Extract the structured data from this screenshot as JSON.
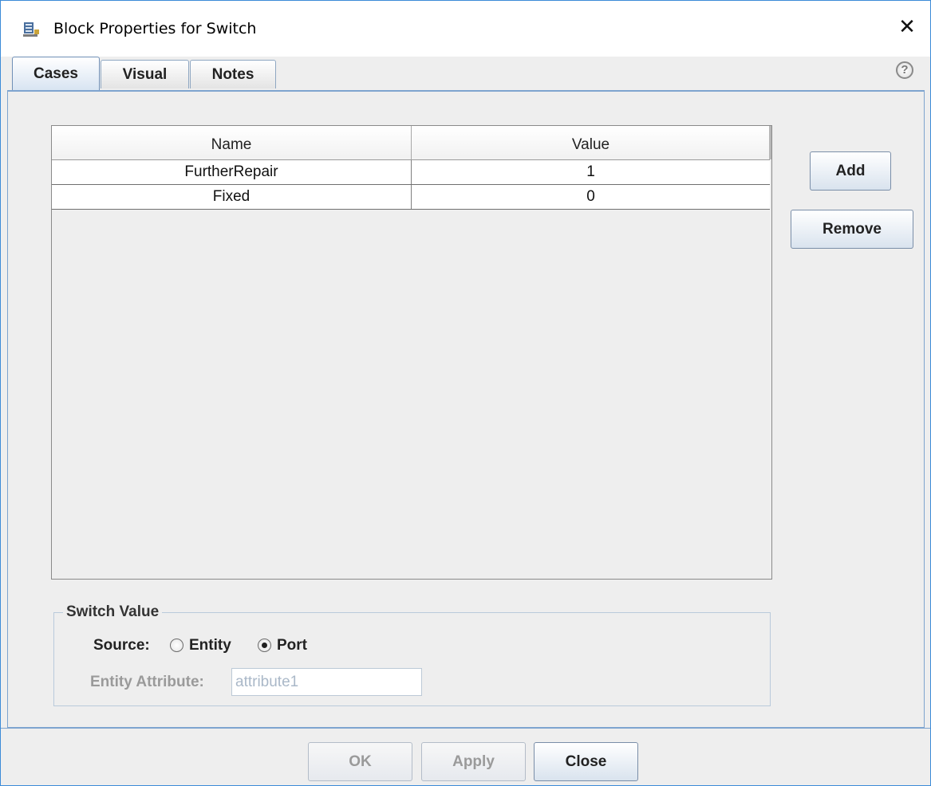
{
  "window": {
    "title": "Block Properties for Switch",
    "app_icon": "block-properties-icon",
    "close_glyph": "✕"
  },
  "tabs": [
    {
      "label": "Cases",
      "active": true
    },
    {
      "label": "Visual",
      "active": false
    },
    {
      "label": "Notes",
      "active": false
    }
  ],
  "help": {
    "glyph": "?"
  },
  "cases_table": {
    "columns": [
      "Name",
      "Value"
    ],
    "rows": [
      [
        "FurtherRepair",
        "1"
      ],
      [
        "Fixed",
        "0"
      ]
    ]
  },
  "side_buttons": {
    "add": "Add",
    "remove": "Remove"
  },
  "switch_value": {
    "title": "Switch Value",
    "source_label": "Source:",
    "options": [
      {
        "label": "Entity",
        "checked": false
      },
      {
        "label": "Port",
        "checked": true
      }
    ],
    "entity_attribute_label": "Entity Attribute:",
    "entity_attribute_value": "attribute1"
  },
  "footer": {
    "ok": "OK",
    "apply": "Apply",
    "close": "Close"
  },
  "colors": {
    "accent": "#3c8bd8",
    "panel": "#eeeeee",
    "disabled_text": "#9a9a9a"
  }
}
